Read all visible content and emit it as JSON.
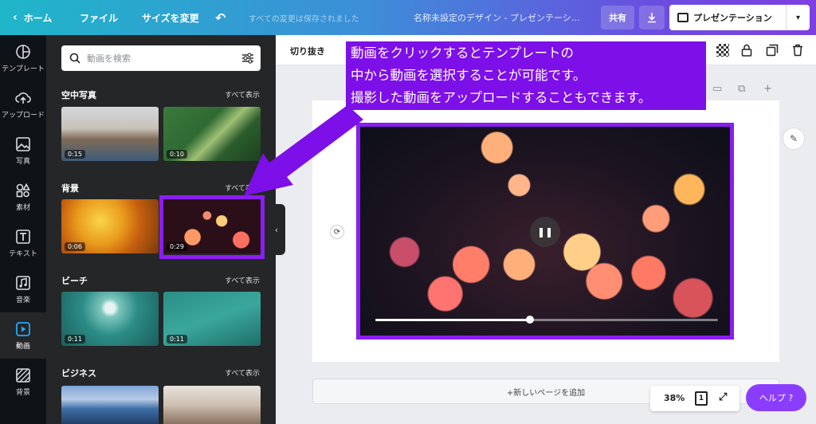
{
  "topbar": {
    "home_label": "ホーム",
    "file_label": "ファイル",
    "resize_label": "サイズを変更",
    "saved_status": "すべての変更は保存されました",
    "doc_title": "名称未設定のデザイン - プレゼンテーシ…",
    "share_label": "共有",
    "present_label": "プレゼンテーション"
  },
  "rail": {
    "items": [
      {
        "label": "テンプレート",
        "icon": "template-icon"
      },
      {
        "label": "アップロード",
        "icon": "upload-icon"
      },
      {
        "label": "写真",
        "icon": "photo-icon"
      },
      {
        "label": "素材",
        "icon": "elements-icon"
      },
      {
        "label": "テキスト",
        "icon": "text-icon"
      },
      {
        "label": "音楽",
        "icon": "music-icon"
      },
      {
        "label": "動画",
        "icon": "video-icon"
      },
      {
        "label": "背景",
        "icon": "background-icon"
      }
    ]
  },
  "panel": {
    "search_placeholder": "動画を検索",
    "see_all": "すべて表示",
    "sections": [
      {
        "title": "空中写真",
        "durations": [
          "0:15",
          "0:10"
        ]
      },
      {
        "title": "背景",
        "durations": [
          "0:06",
          "0:29"
        ]
      },
      {
        "title": "ビーチ",
        "durations": [
          "0:11",
          "0:11"
        ]
      },
      {
        "title": "ビジネス",
        "durations": []
      }
    ]
  },
  "toolbar": {
    "crop_label": "切り抜き"
  },
  "video": {
    "progress": 0.45
  },
  "editor": {
    "add_page_label": "+新しいページを追加",
    "zoom": "38%",
    "page_number": "1",
    "help_label": "ヘルプ ?"
  },
  "callout": {
    "lines": [
      "動画をクリックするとテンプレートの",
      "中から動画を選択することが可能です。",
      "撮影した動画をアップロードすることもできます。"
    ]
  },
  "colors": {
    "accent": "#8a1df2",
    "help": "#8b3dff"
  }
}
